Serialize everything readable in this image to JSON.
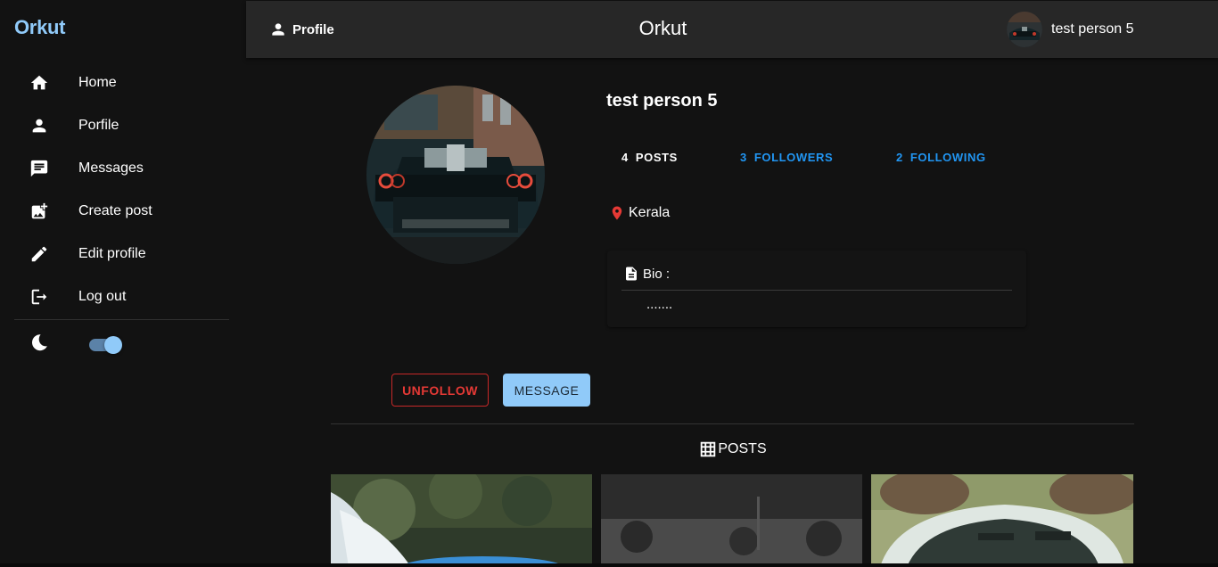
{
  "sidebar": {
    "brand": "Orkut",
    "items": [
      {
        "label": "Home",
        "icon": "home-icon"
      },
      {
        "label": "Porfile",
        "icon": "person-icon"
      },
      {
        "label": "Messages",
        "icon": "message-icon"
      },
      {
        "label": "Create post",
        "icon": "add-photo-icon"
      },
      {
        "label": "Edit profile",
        "icon": "pencil-icon"
      },
      {
        "label": "Log out",
        "icon": "logout-icon"
      }
    ],
    "theme": {
      "icon": "moon-icon",
      "dark_mode": true
    }
  },
  "topbar": {
    "profile_label": "Profile",
    "title": "Orkut",
    "user_name": "test person 5"
  },
  "profile": {
    "name": "test person 5",
    "stats": {
      "posts_count": "4",
      "posts_label": "POSTS",
      "followers_count": "3",
      "followers_label": "FOLLOWERS",
      "following_count": "2",
      "following_label": "FOLLOWING"
    },
    "location": "Kerala",
    "bio_label": "Bio :",
    "bio_text": "......."
  },
  "actions": {
    "unfollow_label": "UNFOLLOW",
    "message_label": "MESSAGE"
  },
  "posts_section": {
    "label": "POSTS"
  },
  "colors": {
    "accent": "#90caf9",
    "link": "#2196f3",
    "danger": "#e53935",
    "background": "#121212",
    "appbar": "#272727"
  }
}
